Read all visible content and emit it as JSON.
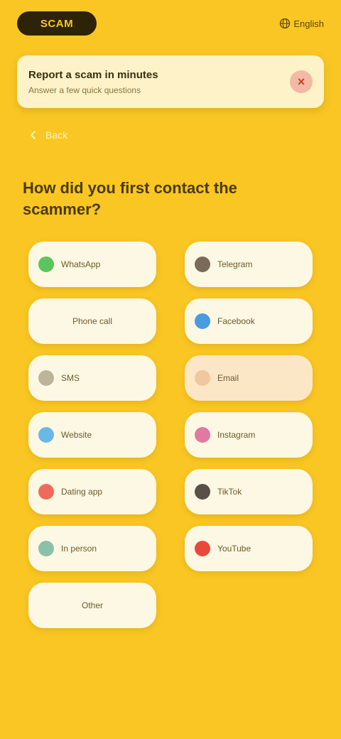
{
  "app": {
    "logo_text": "SCAM"
  },
  "header": {
    "language": "English"
  },
  "banner": {
    "title": "Report a scam in minutes",
    "subtitle": "Answer a few quick questions"
  },
  "nav": {
    "back_label": "Back"
  },
  "question": {
    "title": "How did you first contact the scammer?"
  },
  "options": [
    {
      "label": "WhatsApp",
      "icon_color": "#5cc45c"
    },
    {
      "label": "Telegram",
      "icon_color": "#7a6a5a"
    },
    {
      "label": "Phone call",
      "icon_color": ""
    },
    {
      "label": "Facebook",
      "icon_color": "#4a9be0"
    },
    {
      "label": "SMS",
      "icon_color": "#bdb49a"
    },
    {
      "label": "Email",
      "icon_color": "#f2c6a0"
    },
    {
      "label": "Website",
      "icon_color": "#6ab8e8"
    },
    {
      "label": "Instagram",
      "icon_color": "#e07aa0"
    },
    {
      "label": "Dating app",
      "icon_color": "#ef6a5a"
    },
    {
      "label": "TikTok",
      "icon_color": "#5a5048"
    },
    {
      "label": "In person",
      "icon_color": "#8cc0a8"
    },
    {
      "label": "YouTube",
      "icon_color": "#e84a3a"
    },
    {
      "label": "Other",
      "icon_color": ""
    }
  ],
  "selected_index": 5
}
